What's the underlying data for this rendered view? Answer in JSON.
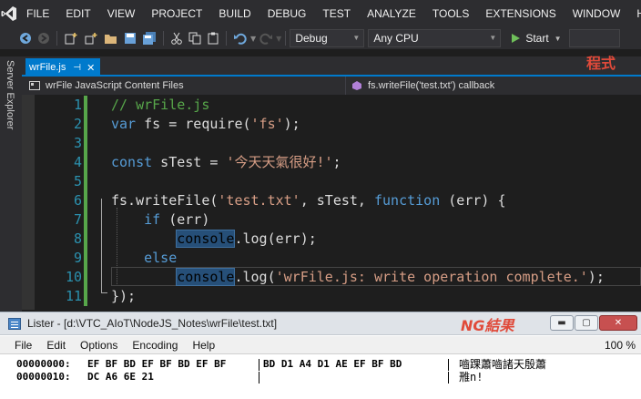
{
  "menubar": {
    "items": [
      "FILE",
      "EDIT",
      "VIEW",
      "PROJECT",
      "BUILD",
      "DEBUG",
      "TEST",
      "ANALYZE",
      "TOOLS",
      "EXTENSIONS",
      "WINDOW",
      "HELP"
    ]
  },
  "toolbar": {
    "config": "Debug",
    "platform": "Any CPU",
    "start_label": "Start",
    "icons": [
      "back-icon",
      "forward-icon",
      "new-project-icon",
      "add-item-icon",
      "open-folder-icon",
      "save-icon",
      "save-all-icon",
      "cut-icon",
      "copy-icon",
      "paste-icon",
      "undo-icon",
      "redo-icon",
      "play-icon"
    ]
  },
  "side_panel": {
    "label": "Server Explorer"
  },
  "tab": {
    "name": "wrFile.js"
  },
  "annotations": {
    "program": "程式",
    "ng_result": "NG結果"
  },
  "navbar": {
    "left": "wrFile JavaScript Content Files",
    "right": "fs.writeFile('test.txt') callback"
  },
  "editor": {
    "line_numbers": [
      "1",
      "2",
      "3",
      "4",
      "5",
      "6",
      "7",
      "8",
      "9",
      "10",
      "11"
    ],
    "lines": [
      [
        {
          "t": "// wrFile.js",
          "c": "comment"
        }
      ],
      [
        {
          "t": "var",
          "c": "key"
        },
        {
          "t": " fs = require(",
          "c": "txt"
        },
        {
          "t": "'fs'",
          "c": "str"
        },
        {
          "t": ");",
          "c": "txt"
        }
      ],
      [],
      [
        {
          "t": "const",
          "c": "key"
        },
        {
          "t": " sTest = ",
          "c": "txt"
        },
        {
          "t": "'今天天氣很好!'",
          "c": "str"
        },
        {
          "t": ";",
          "c": "txt"
        }
      ],
      [],
      [
        {
          "t": "fs.writeFile(",
          "c": "txt"
        },
        {
          "t": "'test.txt'",
          "c": "str"
        },
        {
          "t": ", sTest, ",
          "c": "txt"
        },
        {
          "t": "function",
          "c": "key"
        },
        {
          "t": " (err) {",
          "c": "txt"
        }
      ],
      [
        {
          "t": "    ",
          "c": "txt"
        },
        {
          "t": "if",
          "c": "key"
        },
        {
          "t": " (err)",
          "c": "txt"
        }
      ],
      [
        {
          "t": "        ",
          "c": "txt"
        },
        {
          "t": "console",
          "c": "hl"
        },
        {
          "t": ".log(err);",
          "c": "txt"
        }
      ],
      [
        {
          "t": "    ",
          "c": "txt"
        },
        {
          "t": "else",
          "c": "key"
        }
      ],
      [
        {
          "t": "        ",
          "c": "txt"
        },
        {
          "t": "console",
          "c": "hl"
        },
        {
          "t": ".log(",
          "c": "txt"
        },
        {
          "t": "'wrFile.js: write operation complete.'",
          "c": "str"
        },
        {
          "t": ");",
          "c": "txt"
        }
      ],
      [
        {
          "t": "});",
          "c": "txt"
        }
      ]
    ]
  },
  "lister": {
    "title": "Lister - [d:\\VTC_AIoT\\NodeJS_Notes\\wrFile\\test.txt]",
    "menu": [
      "File",
      "Edit",
      "Options",
      "Encoding",
      "Help"
    ],
    "zoom": "100 %",
    "window_buttons": {
      "minimize": "▬",
      "maximize": "▢",
      "close": "✕"
    },
    "rows": [
      {
        "offset": "00000000:",
        "hex1": "EF BF BD EF BF BD EF BF",
        "hex2": "BD D1 A4 D1 AE EF BF BD",
        "text": "嚙踝蕭嚙諸天殷蕭"
      },
      {
        "offset": "00000010:",
        "hex1": "DC A6 6E 21",
        "hex2": "",
        "text": "雃n!"
      }
    ]
  }
}
